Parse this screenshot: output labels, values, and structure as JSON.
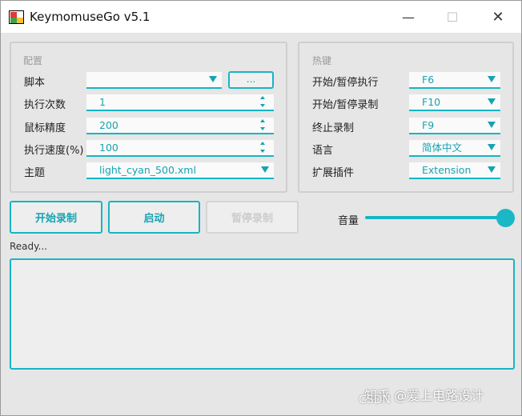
{
  "window": {
    "title": "KeymomuseGo v5.1",
    "minimize_glyph": "—",
    "maximize_glyph": "☐",
    "close_glyph": "✕"
  },
  "config": {
    "group_title": "配置",
    "script_label": "脚本",
    "script_value": "",
    "browse_label": "...",
    "runs_label": "执行次数",
    "runs_value": "1",
    "precision_label": "鼠标精度",
    "precision_value": "200",
    "speed_label": "执行速度(%)",
    "speed_value": "100",
    "theme_label": "主题",
    "theme_value": "light_cyan_500.xml"
  },
  "hotkeys": {
    "group_title": "热键",
    "rows": [
      {
        "label": "开始/暂停执行",
        "value": "F6"
      },
      {
        "label": "开始/暂停录制",
        "value": "F10"
      },
      {
        "label": "终止录制",
        "value": "F9"
      },
      {
        "label": "语言",
        "value": "简体中文"
      },
      {
        "label": "扩展插件",
        "value": "Extension"
      }
    ]
  },
  "actions": {
    "record_label": "开始录制",
    "start_label": "启动",
    "pause_record_label": "暂停录制",
    "volume_label": "音量",
    "volume_level": 1.0
  },
  "status": {
    "text": "Ready...",
    "log": ""
  },
  "colors": {
    "accent": "#17b5c4",
    "disabled": "#d4d4d4",
    "background": "#e6e6e6"
  },
  "watermark": {
    "text": "知乎 @爱上电路设计",
    "text2": "CSDN"
  }
}
